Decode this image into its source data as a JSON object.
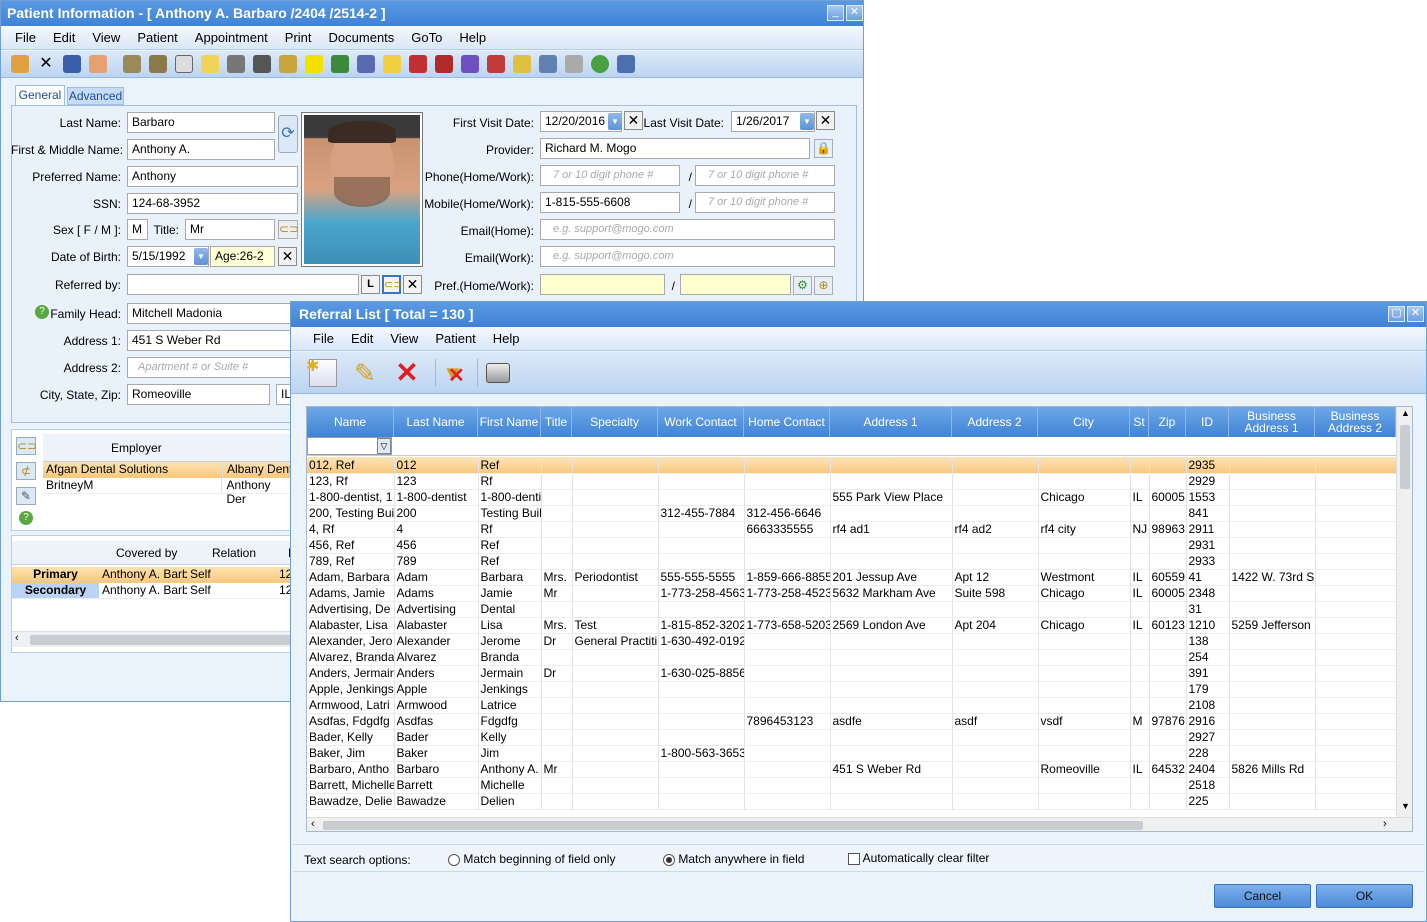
{
  "patient_window": {
    "title": "Patient Information - [ Anthony A. Barbaro /2404 /2514-2 ]",
    "menu": [
      "File",
      "Edit",
      "View",
      "Patient",
      "Appointment",
      "Print",
      "Documents",
      "GoTo",
      "Help"
    ],
    "tabs": [
      "General",
      "Advanced"
    ],
    "labels": {
      "last_name": "Last Name:",
      "first_middle": "First & Middle Name:",
      "preferred": "Preferred Name:",
      "ssn": "SSN:",
      "sex": "Sex [ F / M ]:",
      "title": "Title:",
      "dob": "Date of Birth:",
      "referred_by": "Referred by:",
      "family_head": "Family Head:",
      "address1": "Address 1:",
      "address2": "Address 2:",
      "city_state_zip": "City, State, Zip:",
      "first_visit": "First Visit Date:",
      "last_visit": "Last Visit Date:",
      "provider": "Provider:",
      "phone": "Phone(Home/Work):",
      "mobile": "Mobile(Home/Work):",
      "email_home": "Email(Home):",
      "email_work": "Email(Work):",
      "pref": "Pref.(Home/Work):",
      "slash": "/"
    },
    "values": {
      "last_name": "Barbaro",
      "first_middle": "Anthony A.",
      "preferred": "Anthony",
      "ssn": "124-68-3952",
      "sex": "M",
      "title": "Mr",
      "dob": "5/15/1992",
      "age": "Age:26-2",
      "referred_by": "",
      "family_head": "Mitchell Madonia",
      "address1": "451 S Weber Rd",
      "address2": "",
      "city": "Romeoville",
      "state": "IL",
      "first_visit": "12/20/2016",
      "last_visit": "1/26/2017",
      "provider": "Richard M. Mogo",
      "mobile_home": "1-815-555-6608"
    },
    "placeholders": {
      "address2": "Apartment # or Suite #",
      "phone": "7 or 10 digit phone #",
      "email": "e.g. support@mogo.com"
    },
    "referred_l_button": "L",
    "employer": {
      "header": "Employer",
      "rows": [
        [
          "Afgan Dental Solutions",
          "Albany Dent"
        ],
        [
          "BritneyM",
          "Anthony Der"
        ]
      ]
    },
    "insurance": {
      "headers": [
        "Covered by",
        "Relation",
        "F"
      ],
      "rows": [
        [
          "Primary",
          "Anthony A. Barb",
          "Self",
          "12"
        ],
        [
          "Secondary",
          "Anthony A. Barb",
          "Self",
          "12"
        ]
      ]
    }
  },
  "referral_window": {
    "title": "Referral List [ Total = 130 ]",
    "menu": [
      "File",
      "Edit",
      "View",
      "Patient",
      "Help"
    ],
    "columns": [
      "Name",
      "Last Name",
      "First Name",
      "Title",
      "Specialty",
      "Work Contact",
      "Home Contact",
      "Address 1",
      "Address 2",
      "City",
      "St",
      "Zip",
      "ID",
      "Business Address 1",
      "Business Address 2"
    ],
    "rows": [
      [
        "012, Ref",
        "012",
        "Ref",
        "",
        "",
        "",
        "",
        "",
        "",
        "",
        "",
        "",
        "2935",
        "",
        ""
      ],
      [
        "123, Rf",
        "123",
        "Rf",
        "",
        "",
        "",
        "",
        "",
        "",
        "",
        "",
        "",
        "2929",
        "",
        ""
      ],
      [
        "1-800-dentist, 1",
        "1-800-dentist",
        "1-800-dentis",
        "",
        "",
        "",
        "",
        "555 Park View Place",
        "",
        "Chicago",
        "IL",
        "60005",
        "1553",
        "",
        ""
      ],
      [
        "200, Testing Bui",
        "200",
        "Testing Buil",
        "",
        "",
        "312-455-7884",
        "312-456-6646",
        "",
        "",
        "",
        "",
        "",
        "841",
        "",
        ""
      ],
      [
        "4, Rf",
        "4",
        "Rf",
        "",
        "",
        "",
        "6663335555",
        "rf4 ad1",
        "rf4 ad2",
        "rf4 city",
        "NJ",
        "98963",
        "2911",
        "",
        ""
      ],
      [
        "456, Ref",
        "456",
        "Ref",
        "",
        "",
        "",
        "",
        "",
        "",
        "",
        "",
        "",
        "2931",
        "",
        ""
      ],
      [
        "789, Ref",
        "789",
        "Ref",
        "",
        "",
        "",
        "",
        "",
        "",
        "",
        "",
        "",
        "2933",
        "",
        ""
      ],
      [
        "Adam, Barbara",
        "Adam",
        "Barbara",
        "Mrs.",
        "Periodontist",
        "555-555-5555",
        "1-859-666-8855",
        "201 Jessup Ave",
        "Apt 12",
        "Westmont",
        "IL",
        "60559",
        "41",
        "1422 W. 73rd S",
        ""
      ],
      [
        "Adams, Jamie",
        "Adams",
        "Jamie",
        "Mr",
        "",
        "1-773-258-4563",
        "1-773-258-4523",
        "5632 Markham Ave",
        "Suite 598",
        "Chicago",
        "IL",
        "60005",
        "2348",
        "",
        ""
      ],
      [
        "Advertising, De",
        "Advertising",
        "Dental",
        "",
        "",
        "",
        "",
        "",
        "",
        "",
        "",
        "",
        "31",
        "",
        ""
      ],
      [
        "Alabaster, Lisa",
        "Alabaster",
        "Lisa",
        "Mrs.",
        "Test",
        "1-815-852-3202",
        "1-773-658-5203",
        "2569 London Ave",
        "Apt 204",
        "Chicago",
        "IL",
        "60123",
        "1210",
        "5259 Jefferson",
        ""
      ],
      [
        "Alexander, Jero",
        "Alexander",
        "Jerome",
        "Dr",
        "General Practiti",
        "1-630-492-0192",
        "",
        "",
        "",
        "",
        "",
        "",
        "138",
        "",
        ""
      ],
      [
        "Alvarez, Branda",
        "Alvarez",
        "Branda",
        "",
        "",
        "",
        "",
        "",
        "",
        "",
        "",
        "",
        "254",
        "",
        ""
      ],
      [
        "Anders, Jermain",
        "Anders",
        "Jermain",
        "Dr",
        "",
        "1-630-025-8856",
        "",
        "",
        "",
        "",
        "",
        "",
        "391",
        "",
        ""
      ],
      [
        "Apple, Jenkings",
        "Apple",
        "Jenkings",
        "",
        "",
        "",
        "",
        "",
        "",
        "",
        "",
        "",
        "179",
        "",
        ""
      ],
      [
        "Armwood, Latri",
        "Armwood",
        "Latrice",
        "",
        "",
        "",
        "",
        "",
        "",
        "",
        "",
        "",
        "2108",
        "",
        ""
      ],
      [
        "Asdfas, Fdgdfg",
        "Asdfas",
        "Fdgdfg",
        "",
        "",
        "",
        "7896453123",
        "asdfe",
        "asdf",
        "vsdf",
        "M",
        "97876",
        "2916",
        "",
        ""
      ],
      [
        "Bader, Kelly",
        "Bader",
        "Kelly",
        "",
        "",
        "",
        "",
        "",
        "",
        "",
        "",
        "",
        "2927",
        "",
        ""
      ],
      [
        "Baker, Jim",
        "Baker",
        "Jim",
        "",
        "",
        "1-800-563-3653",
        "",
        "",
        "",
        "",
        "",
        "",
        "228",
        "",
        ""
      ],
      [
        "Barbaro, Antho",
        "Barbaro",
        "Anthony A.",
        "Mr",
        "",
        "",
        "",
        "451 S Weber Rd",
        "",
        "Romeoville",
        "IL",
        "64532",
        "2404",
        "5826 Mills Rd",
        ""
      ],
      [
        "Barrett, Michelle",
        "Barrett",
        "Michelle",
        "",
        "",
        "",
        "",
        "",
        "",
        "",
        "",
        "",
        "2518",
        "",
        ""
      ],
      [
        "Bawadze, Delie",
        "Bawadze",
        "Delien",
        "",
        "",
        "",
        "",
        "",
        "",
        "",
        "",
        "",
        "225",
        "",
        ""
      ]
    ],
    "search_options_label": "Text search options:",
    "opt_begin": "Match beginning of field only",
    "opt_anywhere": "Match anywhere in field",
    "opt_autoclear": "Automatically clear filter",
    "cancel": "Cancel",
    "ok": "OK"
  }
}
